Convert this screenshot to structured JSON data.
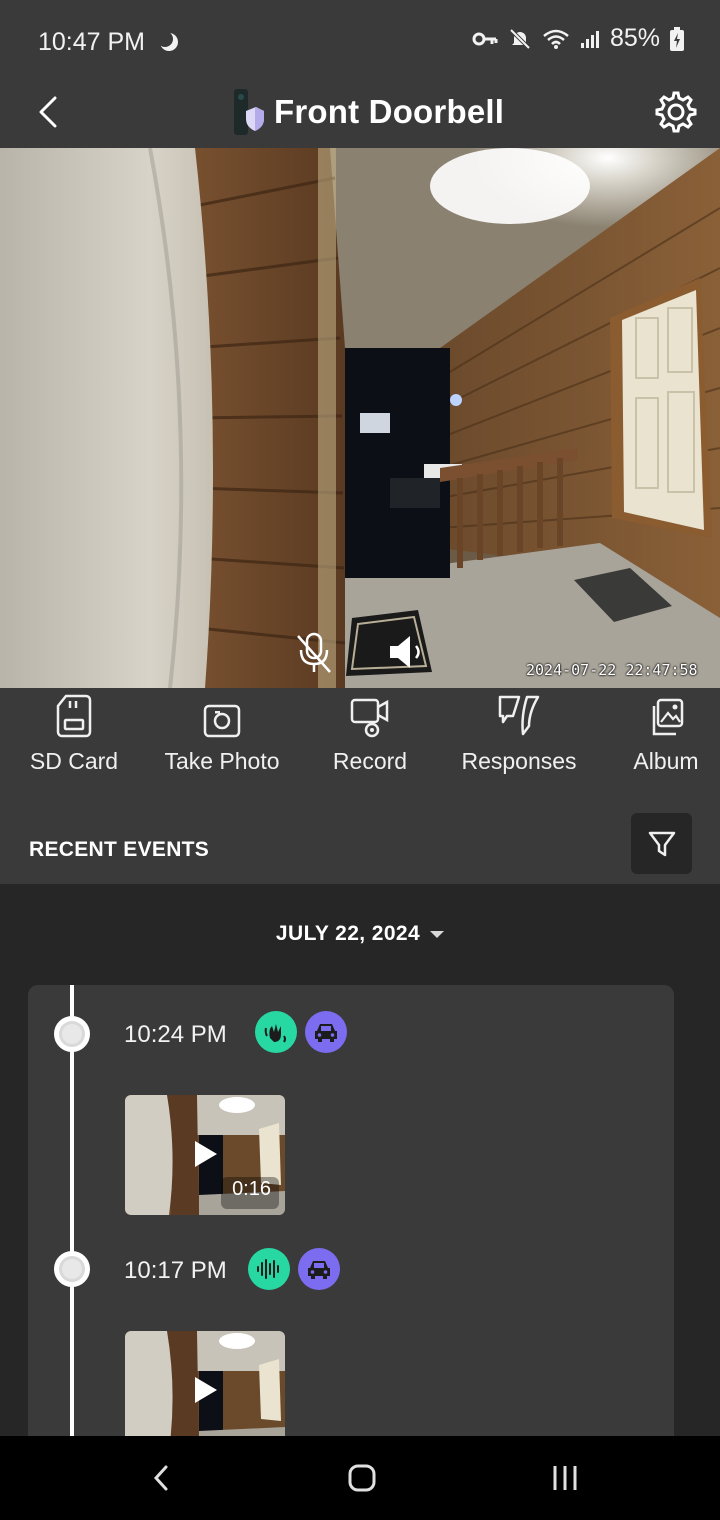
{
  "status_bar": {
    "time": "10:47 PM",
    "battery": "85%"
  },
  "header": {
    "title": "Front Doorbell"
  },
  "camera": {
    "timestamp": "2024-07-22  22:47:58"
  },
  "actions": [
    {
      "label": "SD Card",
      "icon": "sd-card-icon"
    },
    {
      "label": "Take Photo",
      "icon": "camera-icon"
    },
    {
      "label": "Record",
      "icon": "record-icon"
    },
    {
      "label": "Responses",
      "icon": "responses-icon"
    },
    {
      "label": "Album",
      "icon": "album-icon"
    }
  ],
  "events": {
    "title": "RECENT EVENTS",
    "date": "JULY 22, 2024",
    "items": [
      {
        "time": "10:24 PM",
        "badges": [
          "motion-icon",
          "vehicle-icon"
        ],
        "duration": "0:16"
      },
      {
        "time": "10:17 PM",
        "badges": [
          "sound-icon",
          "vehicle-icon"
        ],
        "duration": ""
      }
    ]
  },
  "colors": {
    "accent_green": "#27d8a3",
    "accent_purple": "#7c6cf0",
    "panel": "#3a3a3a",
    "background": "#262626"
  }
}
